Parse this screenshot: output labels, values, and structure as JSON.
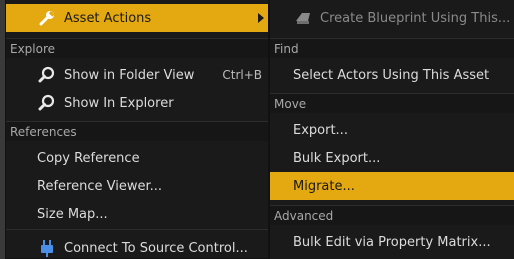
{
  "left_menu": {
    "asset_actions": "Asset Actions",
    "explore_header": "Explore",
    "show_in_folder_view": "Show in Folder View",
    "show_in_folder_view_shortcut": "Ctrl+B",
    "show_in_explorer": "Show In Explorer",
    "references_header": "References",
    "copy_reference": "Copy Reference",
    "reference_viewer": "Reference Viewer...",
    "size_map": "Size Map...",
    "connect_source_control": "Connect To Source Control..."
  },
  "right_menu": {
    "create_blueprint": "Create Blueprint Using This...",
    "find_header": "Find",
    "select_actors": "Select Actors Using This Asset",
    "move_header": "Move",
    "export": "Export...",
    "bulk_export": "Bulk Export...",
    "migrate": "Migrate...",
    "advanced_header": "Advanced",
    "bulk_edit": "Bulk Edit via Property Matrix..."
  },
  "colors": {
    "highlight": "#e4a810",
    "menu_bg": "#1a1a1a",
    "text": "#dcdcdc"
  }
}
